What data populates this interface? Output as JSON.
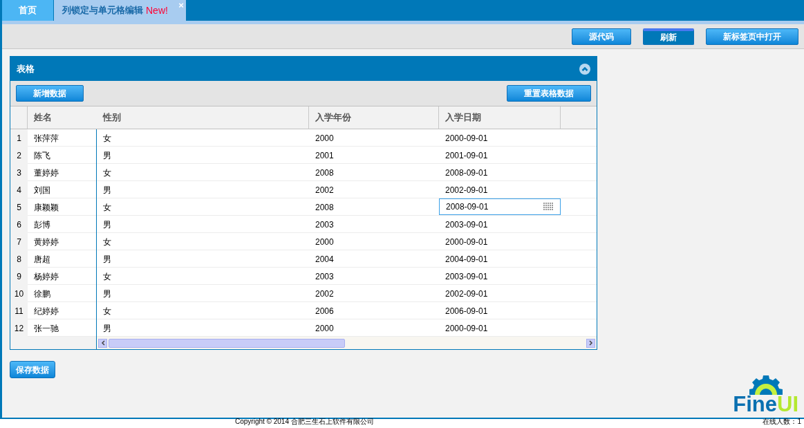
{
  "tabs": [
    {
      "label": "首页",
      "selected": false
    },
    {
      "label": "列锁定与单元格编辑",
      "badge": "New!",
      "selected": true,
      "close": "×"
    }
  ],
  "toolbar": {
    "buttons": [
      {
        "label": "源代码",
        "pressed": false
      },
      {
        "label": "刷新",
        "pressed": true
      },
      {
        "label": "新标签页中打开",
        "pressed": false
      }
    ]
  },
  "panel": {
    "title": "表格",
    "expanded": true,
    "toolbar": {
      "left_button": "新增数据",
      "right_button": "重置表格数据"
    },
    "grid": {
      "columns": [
        "姓名",
        "性别",
        "入学年份",
        "入学日期"
      ],
      "rows": [
        {
          "number": "1",
          "name": "张萍萍",
          "gender": "女",
          "year": "2000",
          "date": "2000-09-01",
          "editing": false
        },
        {
          "number": "2",
          "name": "陈飞",
          "gender": "男",
          "year": "2001",
          "date": "2001-09-01",
          "editing": false
        },
        {
          "number": "3",
          "name": "董婷婷",
          "gender": "女",
          "year": "2008",
          "date": "2008-09-01",
          "editing": false
        },
        {
          "number": "4",
          "name": "刘国",
          "gender": "男",
          "year": "2002",
          "date": "2002-09-01",
          "editing": false
        },
        {
          "number": "5",
          "name": "康颖颖",
          "gender": "女",
          "year": "2008",
          "date": "2008-09-01",
          "editing": true
        },
        {
          "number": "6",
          "name": "彭博",
          "gender": "男",
          "year": "2003",
          "date": "2003-09-01",
          "editing": false
        },
        {
          "number": "7",
          "name": "黄婷婷",
          "gender": "女",
          "year": "2000",
          "date": "2000-09-01",
          "editing": false
        },
        {
          "number": "8",
          "name": "唐超",
          "gender": "男",
          "year": "2004",
          "date": "2004-09-01",
          "editing": false
        },
        {
          "number": "9",
          "name": "杨婷婷",
          "gender": "女",
          "year": "2003",
          "date": "2003-09-01",
          "editing": false
        },
        {
          "number": "10",
          "name": "徐鹏",
          "gender": "男",
          "year": "2002",
          "date": "2002-09-01",
          "editing": false
        },
        {
          "number": "11",
          "name": "纪婷婷",
          "gender": "女",
          "year": "2006",
          "date": "2006-09-01",
          "editing": false
        },
        {
          "number": "12",
          "name": "张一驰",
          "gender": "男",
          "year": "2000",
          "date": "2000-09-01",
          "editing": false
        }
      ]
    }
  },
  "save_button": "保存数据",
  "logo": {
    "part_1": "Fine",
    "part_2": "UI"
  },
  "footer": {
    "copyright": "Copyright © 2014 合肥三生石上软件有限公司",
    "online": "在线人数：1"
  }
}
